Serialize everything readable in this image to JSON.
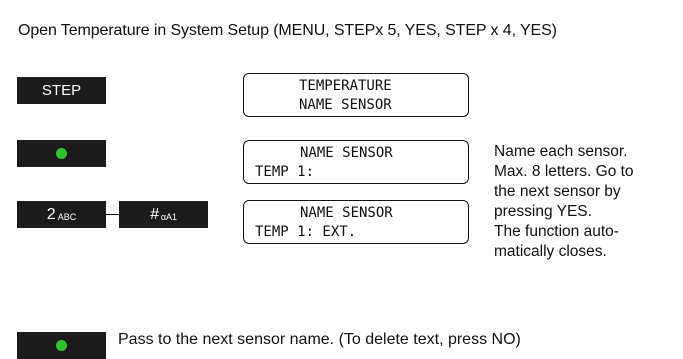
{
  "header": {
    "text": "Open Temperature in System Setup (MENU, STEPx 5, YES, STEP x 4, YES)"
  },
  "keys": {
    "step": "STEP",
    "two": {
      "main": "2",
      "sub": "ABC"
    },
    "hash": {
      "main": "#",
      "sub": "αA1"
    }
  },
  "displays": [
    {
      "line1": "TEMPERATURE",
      "line2": "NAME SENSOR"
    },
    {
      "line1": "NAME SENSOR",
      "line2": "TEMP 1:"
    },
    {
      "line1": "NAME SENSOR",
      "line2": "TEMP 1: EXT."
    }
  ],
  "description": {
    "lines": [
      "Name each sensor.",
      "Max. 8 letters. Go to",
      "the next sensor by",
      "pressing YES.",
      "The function auto-",
      "matically closes."
    ]
  },
  "footer": {
    "text": "Pass to the next sensor name. (To delete text, press NO)"
  },
  "colors": {
    "key_bg": "#1c1c1c",
    "key_text": "#ffffff",
    "led_green": "#2ec32e"
  }
}
